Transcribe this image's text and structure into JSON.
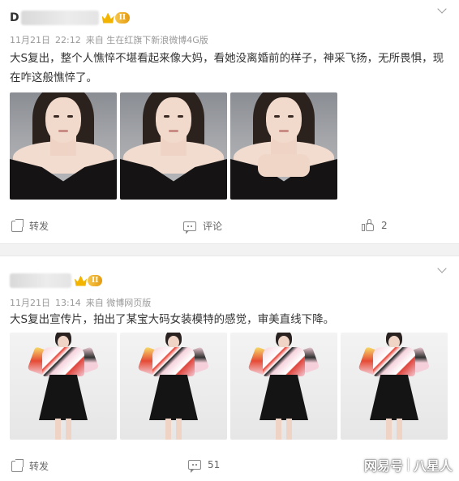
{
  "posts": [
    {
      "user_initial": "D",
      "vip_badge": "II",
      "date": "11月21日",
      "time": "22:12",
      "source": "来自 生在红旗下新浪微博4G版",
      "text": "大S复出，整个人憔悴不堪看起来像大妈，看她没离婚前的样子，神采飞扬，无所畏惧，现在咋这般憔悴了。",
      "actions": {
        "share_label": "转发",
        "comment_label": "评论",
        "like_count": "2"
      }
    },
    {
      "vip_badge": "II",
      "date": "11月21日",
      "time": "13:14",
      "source": "来自 微博网页版",
      "text": "大S复出宣传片，拍出了某宝大码女装模特的感觉，审美直线下降。",
      "actions": {
        "share_label": "转发",
        "comment_count": "51"
      }
    }
  ],
  "watermark": {
    "brand": "网易号",
    "author": "八星人"
  }
}
